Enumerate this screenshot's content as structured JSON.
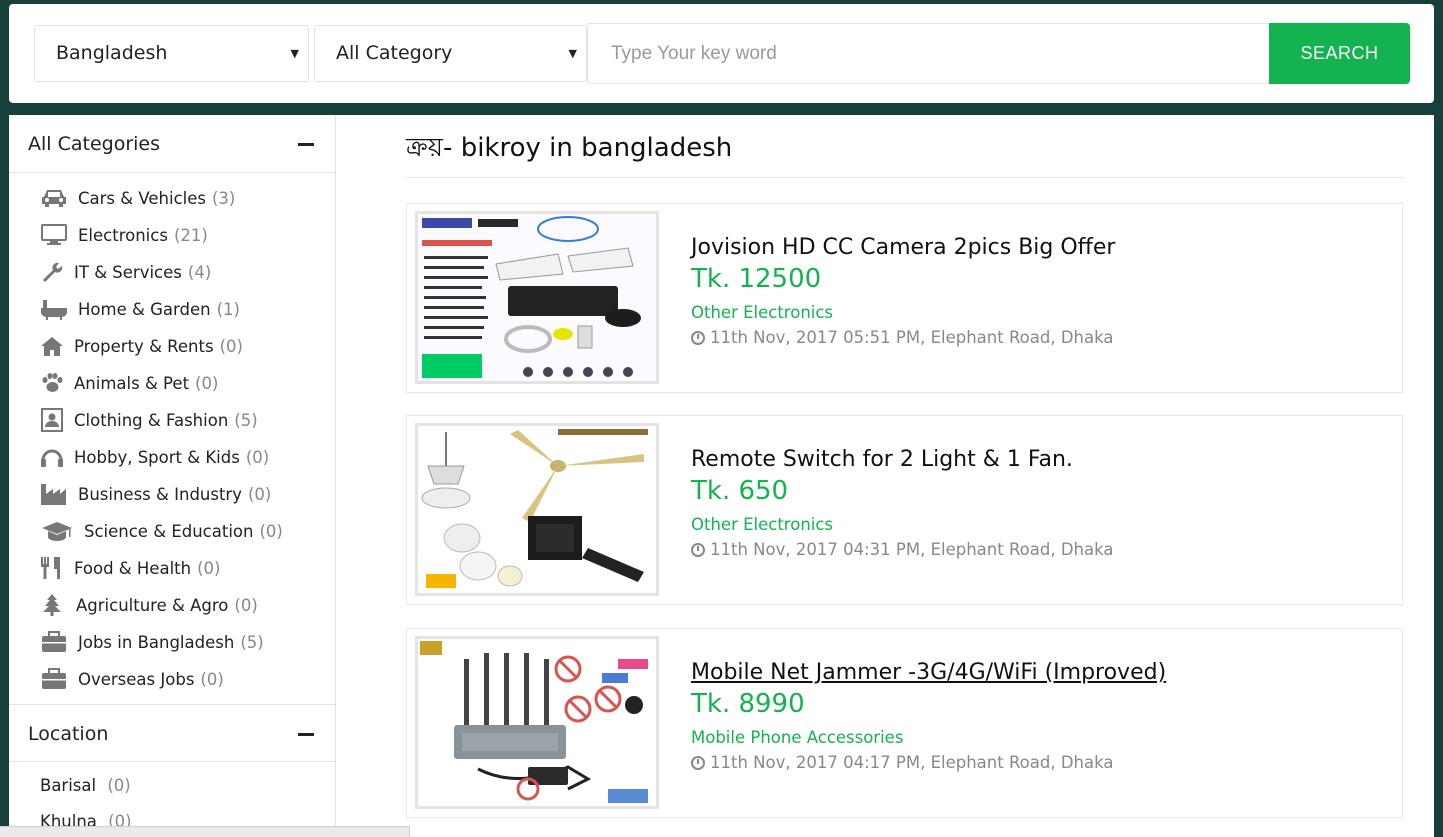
{
  "search": {
    "country": "Bangladesh",
    "category": "All Category",
    "placeholder": "Type Your key word",
    "button_label": "SEARCH"
  },
  "sidebar": {
    "categories_heading": "All Categories",
    "categories": [
      {
        "label": "Cars & Vehicles",
        "count": "(3)",
        "icon": "car-icon"
      },
      {
        "label": "Electronics",
        "count": "(21)",
        "icon": "monitor-icon"
      },
      {
        "label": "IT & Services",
        "count": "(4)",
        "icon": "wrench-icon"
      },
      {
        "label": "Home & Garden",
        "count": "(1)",
        "icon": "bathtub-icon"
      },
      {
        "label": "Property & Rents",
        "count": "(0)",
        "icon": "home-icon"
      },
      {
        "label": "Animals & Pet",
        "count": "(0)",
        "icon": "paw-icon"
      },
      {
        "label": "Clothing & Fashion",
        "count": "(5)",
        "icon": "id-badge-icon"
      },
      {
        "label": "Hobby, Sport & Kids",
        "count": "(0)",
        "icon": "headphones-icon"
      },
      {
        "label": "Business & Industry",
        "count": "(0)",
        "icon": "industry-icon"
      },
      {
        "label": "Science & Education",
        "count": "(0)",
        "icon": "graduation-cap-icon"
      },
      {
        "label": "Food & Health",
        "count": "(0)",
        "icon": "cutlery-icon"
      },
      {
        "label": "Agriculture & Agro",
        "count": "(0)",
        "icon": "tree-icon"
      },
      {
        "label": "Jobs in Bangladesh",
        "count": "(5)",
        "icon": "briefcase-icon"
      },
      {
        "label": "Overseas Jobs",
        "count": "(0)",
        "icon": "briefcase-icon"
      }
    ],
    "location_heading": "Location",
    "locations": [
      {
        "label": "Barisal",
        "count": "(0)"
      },
      {
        "label": "Khulna",
        "count": "(0)"
      }
    ]
  },
  "main": {
    "page_title": "ক্রয়- bikroy in bangladesh",
    "ads": [
      {
        "title": "Jovision HD CC Camera 2pics Big Offer",
        "price": "Tk. 12500",
        "category": "Other Electronics",
        "meta": "11th Nov, 2017 05:51 PM, Elephant Road, Dhaka"
      },
      {
        "title": "Remote Switch for 2 Light & 1 Fan.",
        "price": "Tk. 650",
        "category": "Other Electronics",
        "meta": "11th Nov, 2017 04:31 PM, Elephant Road, Dhaka"
      },
      {
        "title": "Mobile Net Jammer -3G/4G/WiFi (Improved)",
        "price": "Tk. 8990",
        "category": "Mobile Phone Accessories",
        "meta": "11th Nov, 2017 04:17 PM, Elephant Road, Dhaka"
      }
    ]
  },
  "colors": {
    "page_bg": "#18403a",
    "accent_green": "#13b350"
  }
}
